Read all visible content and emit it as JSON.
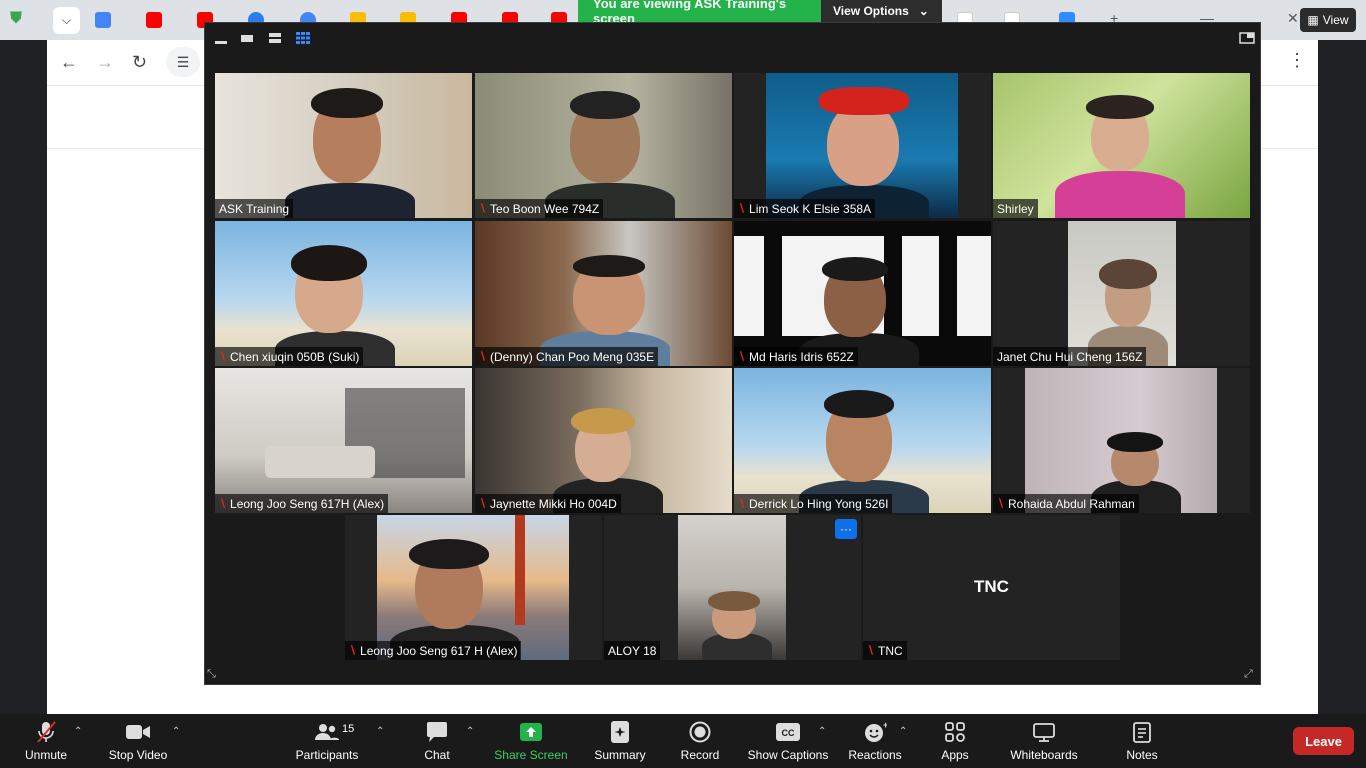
{
  "banner": {
    "share_text": "You are viewing ASK Training's screen",
    "view_options": "View Options"
  },
  "browser": {
    "view_button": "View"
  },
  "participants_tiles": [
    {
      "name": "ASK Training",
      "muted": false,
      "active": true
    },
    {
      "name": "Teo Boon Wee 794Z",
      "muted": true
    },
    {
      "name": "Lim Seok K Elsie 358A",
      "muted": true
    },
    {
      "name": "Shirley",
      "muted": false
    },
    {
      "name": "Chen xiuqin 050B (Suki)",
      "muted": true
    },
    {
      "name": "(Denny) Chan Poo Meng 035E",
      "muted": true
    },
    {
      "name": "Md Haris Idris 652Z",
      "muted": true
    },
    {
      "name": "Janet Chu Hui Cheng 156Z",
      "muted": false
    },
    {
      "name": "Leong Joo Seng 617H (Alex)",
      "muted": true
    },
    {
      "name": "Jaynette Mikki Ho 004D",
      "muted": true
    },
    {
      "name": "Derrick Lo Hing Yong 526I",
      "muted": true
    },
    {
      "name": "Rohaida Abdul Rahman",
      "muted": true
    },
    {
      "name": "Leong Joo Seng 617 H (Alex)",
      "muted": true
    },
    {
      "name": "ALOY 18",
      "muted": false
    },
    {
      "name": "TNC",
      "muted": true,
      "center_text": "TNC"
    }
  ],
  "toolbar": {
    "unmute": "Unmute",
    "stop_video": "Stop Video",
    "participants": "Participants",
    "participants_count": "15",
    "chat": "Chat",
    "share_screen": "Share Screen",
    "summary": "Summary",
    "record": "Record",
    "show_captions": "Show Captions",
    "reactions": "Reactions",
    "apps": "Apps",
    "whiteboards": "Whiteboards",
    "notes": "Notes",
    "leave": "Leave",
    "more_dots": "···"
  },
  "colors": {
    "share_green": "#23b34a",
    "leave_red": "#c62828",
    "active_speaker": "#e6e25a",
    "muted_red": "#e02828"
  }
}
